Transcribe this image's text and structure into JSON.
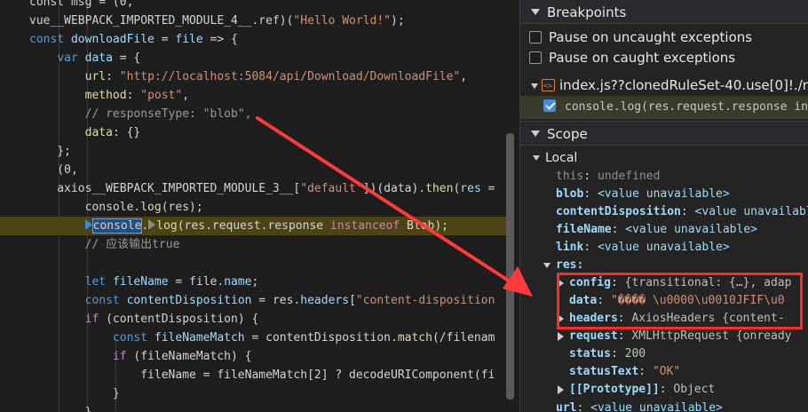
{
  "editor": {
    "lines": [
      [
        [
          "tx",
          "const msg = (0,"
        ]
      ],
      [
        [
          "tx",
          "vue__WEBPACK_IMPORTED_MODULE_4__.ref)("
        ],
        [
          "str",
          "\"Hello World!\""
        ],
        [
          "tx",
          ");"
        ]
      ],
      [
        [
          "kw2",
          "const "
        ],
        [
          "vr",
          "downloadFile"
        ],
        [
          "tx",
          " = "
        ],
        [
          "vr",
          "file"
        ],
        [
          "tx",
          " => {"
        ]
      ],
      [
        [
          "tx",
          "    "
        ],
        [
          "kw2",
          "var "
        ],
        [
          "vr",
          "data"
        ],
        [
          "tx",
          " = {"
        ]
      ],
      [
        [
          "tx",
          "        "
        ],
        [
          "prop",
          "url"
        ],
        [
          "tx",
          ": "
        ],
        [
          "str",
          "\"http://localhost:5084/api/Download/DownloadFile\""
        ],
        [
          "tx",
          ","
        ]
      ],
      [
        [
          "tx",
          "        "
        ],
        [
          "prop",
          "method"
        ],
        [
          "tx",
          ": "
        ],
        [
          "str",
          "\"post\""
        ],
        [
          "tx",
          ","
        ]
      ],
      [
        [
          "tx",
          "        "
        ],
        [
          "cm",
          "// responseType: \"blob\","
        ]
      ],
      [
        [
          "tx",
          "        "
        ],
        [
          "prop",
          "data"
        ],
        [
          "tx",
          ": {}"
        ]
      ],
      [
        [
          "tx",
          "    };"
        ]
      ],
      [
        [
          "tx",
          "    (0,"
        ]
      ],
      [
        [
          "tx",
          "    axios__WEBPACK_IMPORTED_MODULE_3__["
        ],
        [
          "str",
          "\"default\""
        ],
        [
          "tx",
          "])(data)."
        ],
        [
          "fn",
          "then"
        ],
        [
          "tx",
          "("
        ],
        [
          "vr",
          "res"
        ],
        [
          "tx",
          " ="
        ]
      ],
      [
        [
          "tx",
          "        console."
        ],
        [
          "fn",
          "log"
        ],
        [
          "tx",
          "(res);"
        ]
      ],
      [
        [
          "tx",
          "        "
        ],
        [
          "bp",
          ""
        ],
        [
          "sel",
          "console"
        ],
        [
          "tx",
          "."
        ],
        [
          "bpg",
          ""
        ],
        [
          "fn",
          "log"
        ],
        [
          "tx",
          "(res.request.response "
        ],
        [
          "kw",
          "instanceof"
        ],
        [
          "tx",
          " Blob);"
        ]
      ],
      [
        [
          "tx",
          "        "
        ],
        [
          "cm",
          "// 应该输出true"
        ]
      ],
      [
        [
          "tx",
          ""
        ]
      ],
      [
        [
          "tx",
          "        "
        ],
        [
          "kw2",
          "let "
        ],
        [
          "vr",
          "fileName"
        ],
        [
          "tx",
          " = file."
        ],
        [
          "vr",
          "name"
        ],
        [
          "tx",
          ";"
        ]
      ],
      [
        [
          "tx",
          "        "
        ],
        [
          "kw2",
          "const "
        ],
        [
          "vr",
          "contentDisposition"
        ],
        [
          "tx",
          " = res."
        ],
        [
          "vr",
          "headers"
        ],
        [
          "tx",
          "["
        ],
        [
          "str",
          "\"content-disposition"
        ]
      ],
      [
        [
          "tx",
          "        "
        ],
        [
          "kw",
          "if"
        ],
        [
          "tx",
          " (contentDisposition) {"
        ]
      ],
      [
        [
          "tx",
          "            "
        ],
        [
          "kw2",
          "const "
        ],
        [
          "vr",
          "fileNameMatch"
        ],
        [
          "tx",
          " = contentDisposition."
        ],
        [
          "fn",
          "match"
        ],
        [
          "tx",
          "(/filenam"
        ]
      ],
      [
        [
          "tx",
          "            "
        ],
        [
          "kw",
          "if"
        ],
        [
          "tx",
          " (fileNameMatch) {"
        ]
      ],
      [
        [
          "tx",
          "                fileName = fileNameMatch[2] ? decodeURIComponent(fi"
        ]
      ],
      [
        [
          "tx",
          "            }"
        ]
      ],
      [
        [
          "tx",
          "        }"
        ]
      ]
    ]
  },
  "sidebar": {
    "breakpoints_title": "Breakpoints",
    "pause_uncaught": "Pause on uncaught exceptions",
    "pause_caught": "Pause on caught exceptions",
    "file_name": "index.js??clonedRuleSet-40.use[0]!./noc",
    "bp_line_code": "console.log(res.request.response in",
    "scope_title": "Scope",
    "local_label": "Local",
    "scope_items": [
      {
        "key": "this",
        "sep": ": ",
        "value": "undefined",
        "kind": "dim"
      },
      {
        "key": "blob",
        "sep": ": ",
        "value": "<value unavailable>",
        "kind": "unav"
      },
      {
        "key": "contentDisposition",
        "sep": ": ",
        "value": "<value unavailable>",
        "kind": "unav"
      },
      {
        "key": "fileName",
        "sep": ": ",
        "value": "<value unavailable>",
        "kind": "unav"
      },
      {
        "key": "link",
        "sep": ": ",
        "value": "<value unavailable>",
        "kind": "unav"
      }
    ],
    "res_label": "res",
    "res_items": [
      {
        "key": "config",
        "sep": ": ",
        "value": "{transitional: {…}, adap",
        "kind": "obj",
        "expandable": true
      },
      {
        "key": "data",
        "sep": ": ",
        "value": "\"���� \\u0000\\u0010JFIF\\u0",
        "kind": "str",
        "expandable": false
      },
      {
        "key": "headers",
        "sep": ": ",
        "value": "AxiosHeaders  {content-",
        "kind": "obj",
        "expandable": true
      },
      {
        "key": "request",
        "sep": ": ",
        "value": "XMLHttpRequest  {onready",
        "kind": "obj",
        "expandable": true
      },
      {
        "key": "status",
        "sep": ": ",
        "value": "200",
        "kind": "num",
        "expandable": false
      },
      {
        "key": "statusText",
        "sep": ": ",
        "value": "\"OK\"",
        "kind": "str",
        "expandable": false
      },
      {
        "key": "[[Prototype]]",
        "sep": ": ",
        "value": "Object",
        "kind": "proto",
        "expandable": true
      }
    ],
    "url_key": "url",
    "url_value": "<value unavailable>"
  },
  "colors": {
    "highlight_line": "#4d4416",
    "annotation_red": "#ff2a2a",
    "breakpoint_blue": "#3c8bd9"
  }
}
